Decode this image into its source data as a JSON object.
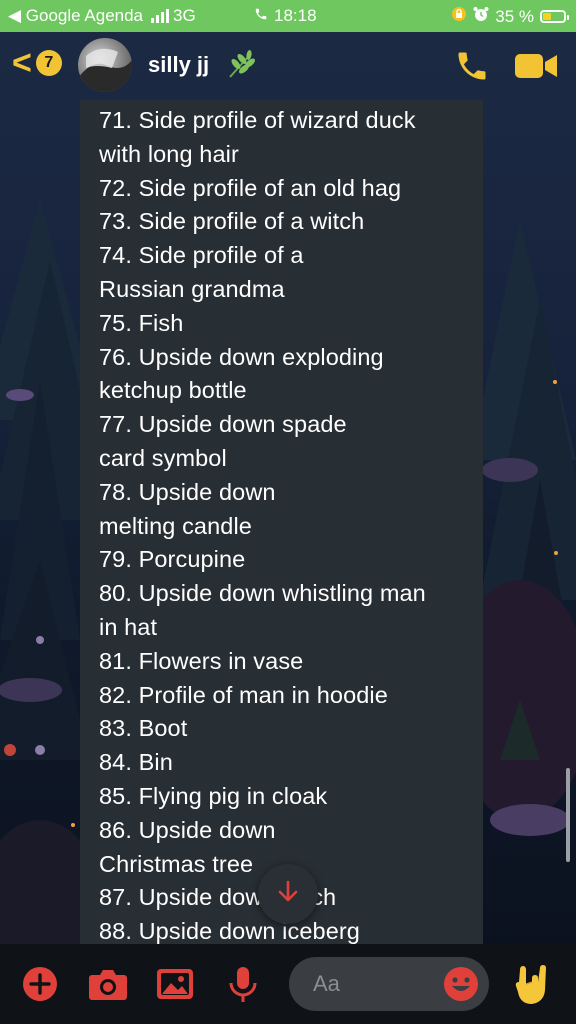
{
  "status_bar": {
    "carrier": "◀ Google Agenda",
    "network": "3G",
    "time": "18:18",
    "battery_percent": "35 %",
    "color": "#6fc85f"
  },
  "header": {
    "unread_count": "7",
    "contact_name": "silly jj",
    "accent_color": "#f2c434"
  },
  "message": {
    "lines": [
      "71. Side profile of wizard duck",
      "with long hair",
      "72. Side profile of an old hag",
      "73. Side profile of a witch",
      "74. Side profile of a",
      "Russian grandma",
      "75. Fish",
      "76. Upside down exploding",
      "ketchup bottle",
      "77. Upside down spade",
      "card symbol",
      "78. Upside down",
      "melting candle",
      "79. Porcupine",
      "80. Upside down whistling man",
      "in hat",
      "81. Flowers in vase",
      "82. Profile of man in hoodie",
      "83. Boot",
      "84. Bin",
      "85. Flying pig in cloak",
      "86. Upside down",
      "Christmas tree",
      "87. Upside down witch",
      "88. Upside down iceberg"
    ]
  },
  "composer": {
    "placeholder": "Aa",
    "icon_color": "#e0403a"
  },
  "icons": {
    "add": "plus-circle-icon",
    "camera": "camera-icon",
    "gallery": "image-icon",
    "mic": "microphone-icon",
    "emoji": "smiley-icon",
    "rock": "rock-hand-icon",
    "scroll": "arrow-down-icon",
    "call": "phone-icon",
    "video": "video-camera-icon"
  }
}
